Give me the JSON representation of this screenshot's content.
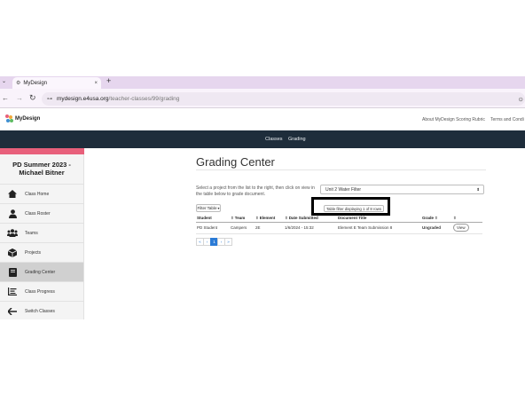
{
  "browser": {
    "tab_menu_icon": "chevron-down-icon",
    "tab_title": "MyDesign",
    "tab_close": "×",
    "new_tab": "+",
    "url_host": "mydesign.e4usa.org",
    "url_path": "/teacher-classes/99/grading",
    "back": "←",
    "forward": "→",
    "reload": "C"
  },
  "site": {
    "logo_text": "MyDesign",
    "top_links": [
      "About MyDesign Scoring Rubric",
      "Terms and Condi"
    ],
    "nav": [
      "Classes",
      "Grading"
    ],
    "nav_bg": "#1e2d3b",
    "accent": "#e8607b"
  },
  "sidebar": {
    "class_title": "PD Summer 2023 - Michael Bitner",
    "items": [
      {
        "label": "Class Home",
        "icon": "home-icon"
      },
      {
        "label": "Class Roster",
        "icon": "user-icon"
      },
      {
        "label": "Teams",
        "icon": "users-icon"
      },
      {
        "label": "Projects",
        "icon": "box-icon"
      },
      {
        "label": "Grading Center",
        "icon": "book-icon",
        "active": true
      },
      {
        "label": "Class Progress",
        "icon": "list-icon"
      },
      {
        "label": "Switch Classes",
        "icon": "arrow-left-icon"
      }
    ]
  },
  "main": {
    "title": "Grading Center",
    "instructions": "Select a project from the list to the right, then click on view in the table below to grade document.",
    "project_select": "Unit 2 Water Filter",
    "filter_button": "Filter Table",
    "filter_status": "Table filter displaying 1 of 8 rows",
    "table": {
      "headers": [
        "Student",
        "Team",
        "Element",
        "Date Submitted",
        "Document Title",
        "Grade",
        ""
      ],
      "rows": [
        {
          "student": "PD Student",
          "team": "Campers",
          "element": "2E",
          "date": "1/6/2024 - 15:32",
          "title": "Element E Team Submission 8",
          "grade": "Ungraded",
          "action": "View"
        }
      ]
    },
    "pager": [
      "«",
      "‹",
      "1",
      "›",
      "»"
    ],
    "current_page": "1"
  }
}
